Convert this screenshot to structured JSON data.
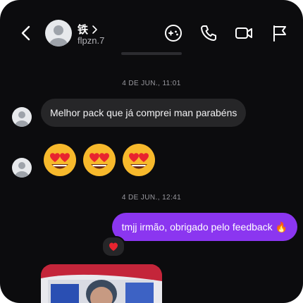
{
  "header": {
    "contact_name": "铁",
    "username": "flpzn.7",
    "icons": [
      "back-arrow-icon",
      "chevron-right-icon",
      "games-icon",
      "phone-icon",
      "video-icon",
      "flag-icon"
    ]
  },
  "messages": [
    {
      "type": "timestamp",
      "text": "4 DE JUN., 11:01"
    },
    {
      "type": "incoming",
      "text": "Melhor pack que já comprei man parabéns"
    },
    {
      "type": "incoming_emoji",
      "emojis": [
        "😍",
        "😍",
        "😍"
      ]
    },
    {
      "type": "timestamp",
      "text": "4 DE JUN., 12:41"
    },
    {
      "type": "outgoing",
      "text": "tmjj irmão, obrigado pelo feedback 🔥",
      "reaction": "❤️"
    },
    {
      "type": "incoming_media"
    }
  ],
  "colors": {
    "background": "#0c0c0e",
    "incoming_bubble": "#262628",
    "outgoing_bubble": "#8b36f0",
    "muted_text": "#9a9aa0"
  }
}
